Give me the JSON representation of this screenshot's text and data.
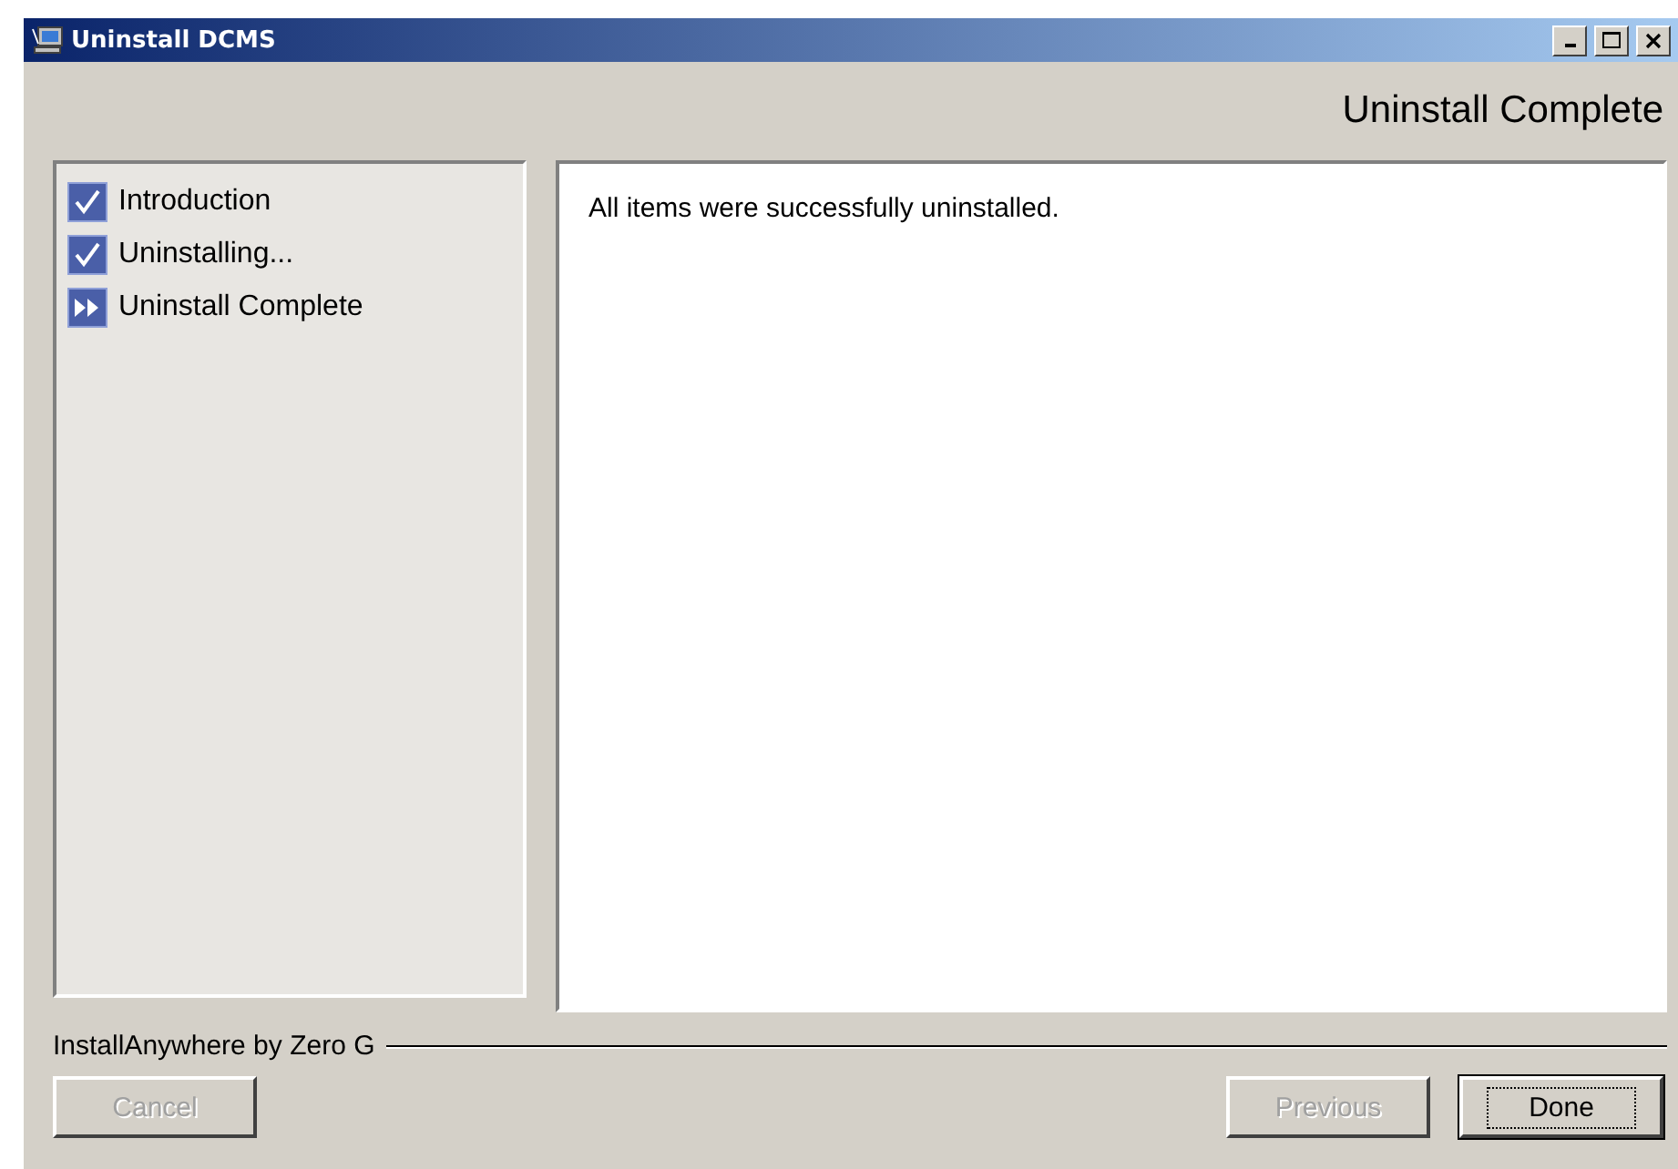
{
  "window": {
    "title": "Uninstall DCMS"
  },
  "header": {
    "title": "Uninstall Complete"
  },
  "steps": [
    {
      "label": "Introduction",
      "kind": "done"
    },
    {
      "label": "Uninstalling...",
      "kind": "done"
    },
    {
      "label": "Uninstall Complete",
      "kind": "current"
    }
  ],
  "content": {
    "message": "All items were successfully uninstalled."
  },
  "branding": "InstallAnywhere by Zero G",
  "buttons": [
    {
      "label": "Cancel",
      "disabled": true,
      "default": false
    },
    {
      "label": "Previous",
      "disabled": true,
      "default": false
    },
    {
      "label": "Done",
      "disabled": false,
      "default": true
    }
  ]
}
